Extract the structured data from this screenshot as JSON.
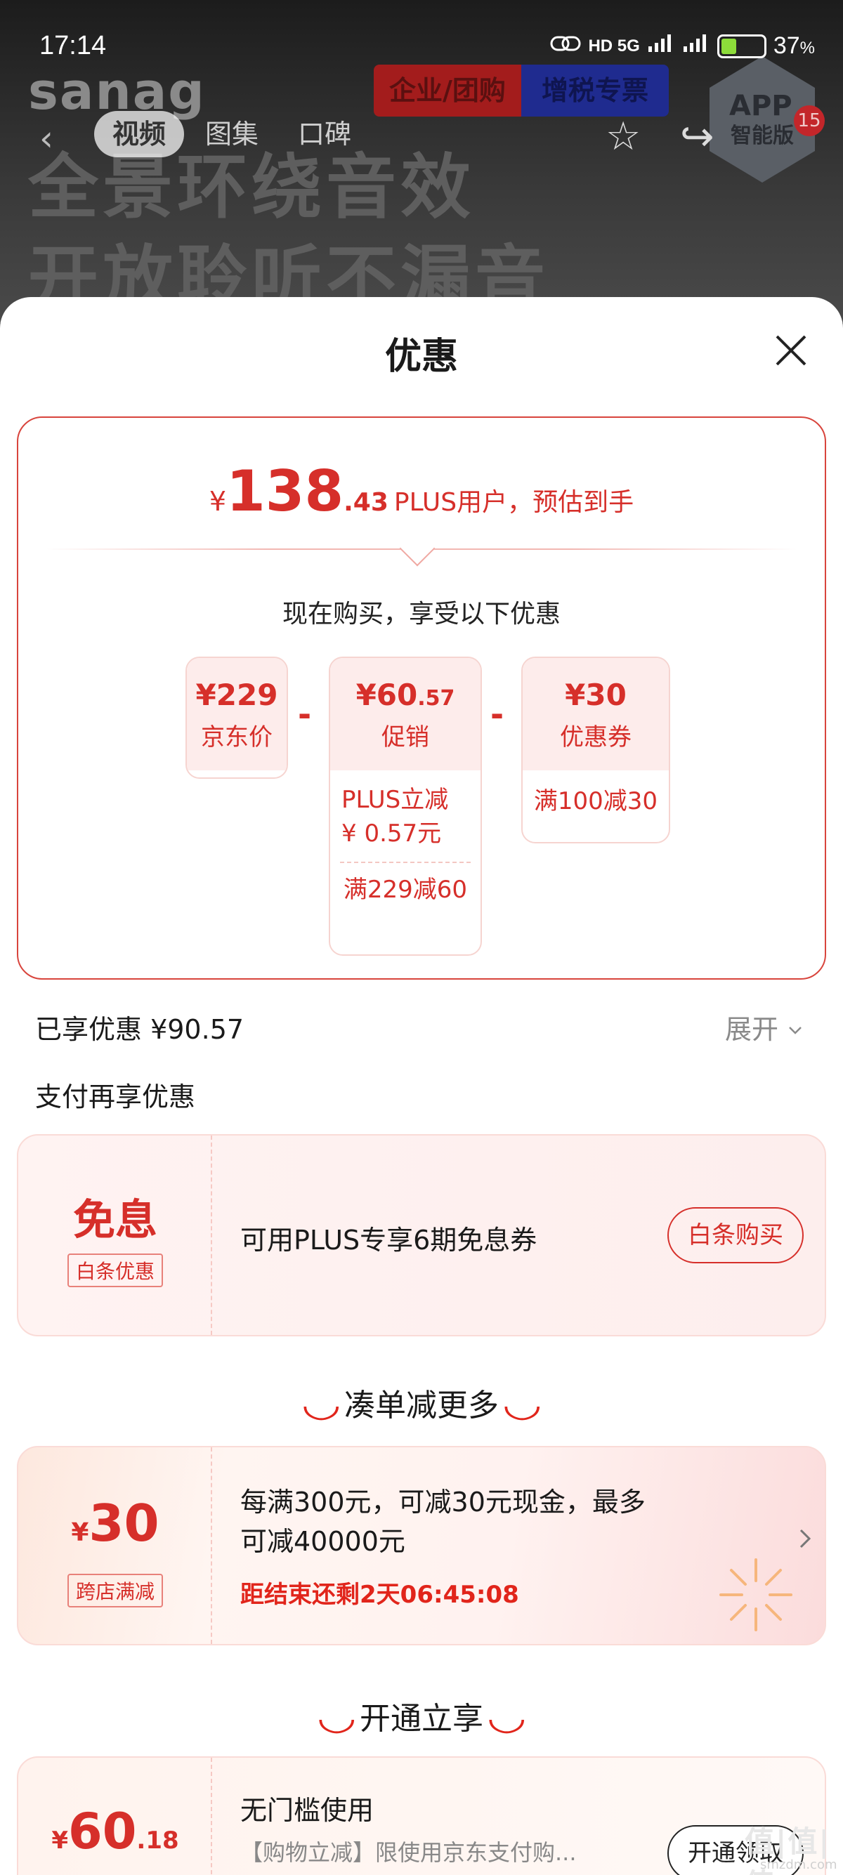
{
  "status_bar": {
    "time": "17:14",
    "network": "HD 5G",
    "battery": "37",
    "battery_unit": "%",
    "battery_level": 0.37
  },
  "background": {
    "brand": "sanag",
    "headline_line1": "全景环绕音效",
    "headline_line2": "开放聆听不漏音",
    "tag_enterprise": "企业/团购",
    "tag_invoice": "增税专票",
    "badge_line1": "APP",
    "badge_line2": "智能版",
    "badge_count": "15"
  },
  "nav": {
    "tabs": [
      "视频",
      "图集",
      "口碑"
    ],
    "active_tab": 0
  },
  "sheet": {
    "title": "优惠",
    "summary": {
      "currency": "¥",
      "price_int": "138",
      "price_dec": ".43",
      "note": "PLUS用户，预估到手",
      "subtitle": "现在购买，享受以下优惠",
      "jd_price": {
        "value": "¥229",
        "label": "京东价"
      },
      "promo": {
        "value": "¥60",
        "value_dec": ".57",
        "label": "促销",
        "detail1": "PLUS立减",
        "detail2": "¥ 0.57元",
        "detail3": "满229减60"
      },
      "coupon": {
        "value": "¥30",
        "label": "优惠券",
        "detail": "满100减30"
      },
      "minus": "-"
    },
    "enjoyed": "已享优惠 ¥90.57",
    "expand": "展开",
    "pay_title": "支付再享优惠",
    "interest_free": {
      "big": "免息",
      "badge": "白条优惠",
      "text": "可用PLUS专享6期免息券",
      "button": "白条购买"
    },
    "section_more": "凑单减更多",
    "cross_store": {
      "currency": "¥",
      "amount": "30",
      "badge": "跨店满减",
      "line1": "每满300元，可减30元现金，最多",
      "line2": "可减40000元",
      "countdown": "距结束还剩2天06:45:08"
    },
    "section_open": "开通立享",
    "open_card": {
      "currency": "¥",
      "amount_int": "60",
      "amount_dec": ".18",
      "title": "无门槛使用",
      "desc": "【购物立减】限使用京东支付购...",
      "button": "开通领取"
    },
    "watermark": "值|值|值",
    "watermark_small": "smzdm.com"
  },
  "colors": {
    "accent": "#e1251b",
    "price_red": "#d62f2a",
    "pink_bg": "#fdeceb"
  }
}
